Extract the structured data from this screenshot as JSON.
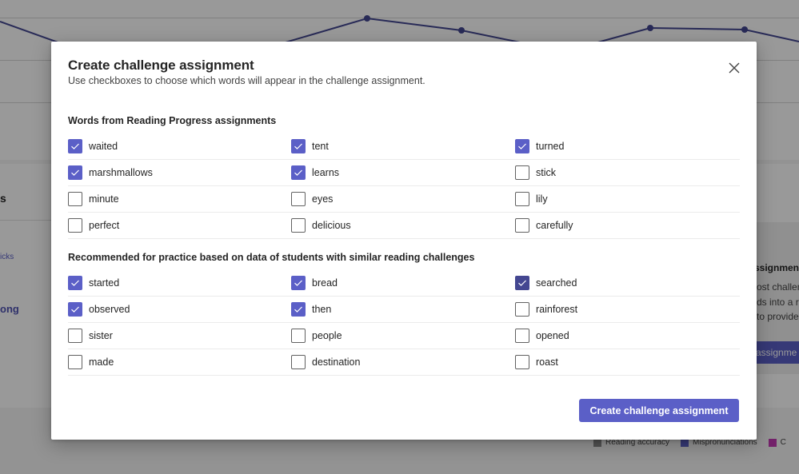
{
  "background": {
    "left_panel": {
      "title_fragment": "s",
      "link_fragment_1": "icks",
      "link_fragment_2": "ong"
    },
    "right_card": {
      "title_fragment": "ssignment",
      "text_lines": [
        "ost challen",
        "ds into a r",
        "to provide"
      ],
      "button_fragment": "assignme"
    },
    "legend": [
      {
        "label": "Reading accuracy",
        "color": "#8a8a8a"
      },
      {
        "label": "Mispronunciations",
        "color": "#5b5fc7"
      },
      {
        "label": "C",
        "color": "#c239b3"
      }
    ],
    "chart_line_color": "#444791"
  },
  "dialog": {
    "title": "Create challenge assignment",
    "subtitle": "Use checkboxes to choose which words will appear in the challenge assignment.",
    "close_icon": "close-icon",
    "sections": [
      {
        "title": "Words from Reading Progress assignments",
        "rows": [
          [
            {
              "word": "waited",
              "checked": true
            },
            {
              "word": "tent",
              "checked": true
            },
            {
              "word": "turned",
              "checked": true
            }
          ],
          [
            {
              "word": "marshmallows",
              "checked": true
            },
            {
              "word": "learns",
              "checked": true
            },
            {
              "word": "stick",
              "checked": false
            }
          ],
          [
            {
              "word": "minute",
              "checked": false
            },
            {
              "word": "eyes",
              "checked": false
            },
            {
              "word": "lily",
              "checked": false
            }
          ],
          [
            {
              "word": "perfect",
              "checked": false
            },
            {
              "word": "delicious",
              "checked": false
            },
            {
              "word": "carefully",
              "checked": false
            }
          ]
        ]
      },
      {
        "title": "Recommended for practice based on data of students with similar reading challenges",
        "rows": [
          [
            {
              "word": "started",
              "checked": true
            },
            {
              "word": "bread",
              "checked": true
            },
            {
              "word": "searched",
              "checked": true,
              "focused": true
            }
          ],
          [
            {
              "word": "observed",
              "checked": true
            },
            {
              "word": "then",
              "checked": true
            },
            {
              "word": "rainforest",
              "checked": false
            }
          ],
          [
            {
              "word": "sister",
              "checked": false
            },
            {
              "word": "people",
              "checked": false
            },
            {
              "word": "opened",
              "checked": false
            }
          ],
          [
            {
              "word": "made",
              "checked": false
            },
            {
              "word": "destination",
              "checked": false
            },
            {
              "word": "roast",
              "checked": false
            }
          ]
        ]
      }
    ],
    "primary_button": "Create challenge assignment",
    "accent_color": "#5b5fc7"
  }
}
